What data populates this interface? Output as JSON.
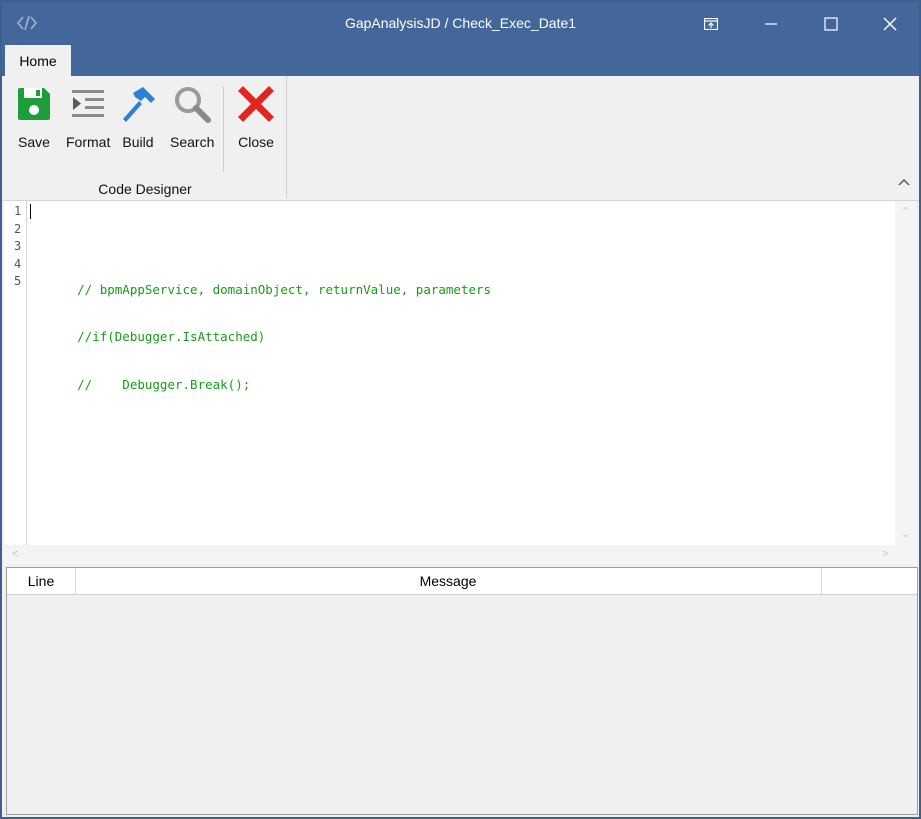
{
  "window": {
    "title": "GapAnalysisJD / Check_Exec_Date1",
    "app_icon": "code-icon",
    "controls": [
      "pin-icon",
      "minimize-icon",
      "maximize-icon",
      "close-icon"
    ]
  },
  "tabs": [
    {
      "label": "Home",
      "active": true
    }
  ],
  "ribbon": {
    "buttons": [
      {
        "label": "Save",
        "icon": "save-icon",
        "color": "#1e9e3a"
      },
      {
        "label": "Format",
        "icon": "format-icon",
        "color": "#808080"
      },
      {
        "label": "Build",
        "icon": "build-hammer-icon",
        "color": "#2f7fd4"
      },
      {
        "label": "Search",
        "icon": "search-icon",
        "color": "#8a8a8a"
      },
      {
        "label": "Close",
        "icon": "close-x-icon",
        "color": "#e0261f"
      }
    ],
    "group_label": "Code Designer"
  },
  "editor": {
    "line_numbers": [
      "1",
      "2",
      "3",
      "4",
      "5"
    ],
    "lines": [
      "",
      "      // bpmAppService, domainObject, returnValue, parameters",
      "      //if(Debugger.IsAttached)",
      "      //    Debugger.Break();",
      ""
    ],
    "comment_color": "#1a9b1a"
  },
  "results": {
    "columns": [
      "Line",
      "Message",
      ""
    ]
  },
  "colors": {
    "titlebar": "#44679b",
    "ribbon_bg": "#f0f0f0"
  }
}
